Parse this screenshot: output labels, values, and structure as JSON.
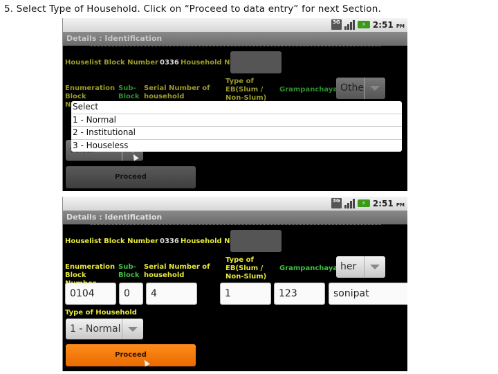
{
  "caption": "5. Select Type of Household.  Click on “Proceed to data entry” for next Section.",
  "status_bar": {
    "network": "3G",
    "time": "2:51",
    "ampm": "PM"
  },
  "screen": {
    "title": "Details : Identification",
    "labels": {
      "houselist_block_number": "Houselist Block Number",
      "household_no": "Household No",
      "enumeration_block_number": "Enumeration Block Number",
      "sub_block": "Sub-Block",
      "serial_number": "Serial Number of household",
      "type_of_eb": "Type of EB(Slum / Non-Slum)",
      "grampanchayat": "Grampanchayat",
      "type_of_household": "Type of Household"
    },
    "houselist_block_number_value": "0336",
    "proceed_label": "Proceed"
  },
  "screen1": {
    "grampanchayat_spinner": "Othe",
    "type_of_household_spinner": "Select",
    "dropdown_options": [
      "Select",
      "1 - Normal",
      "2 - Institutional",
      "3 - Houseless"
    ]
  },
  "screen2": {
    "grampanchayat_spinner": "her",
    "fields": {
      "enumeration_block_number": "0104",
      "sub_block": "0",
      "serial_number": "4",
      "type_of_eb": "1",
      "field5": "123",
      "field6": "sonipat"
    },
    "type_of_household_spinner": "1 - Normal"
  }
}
